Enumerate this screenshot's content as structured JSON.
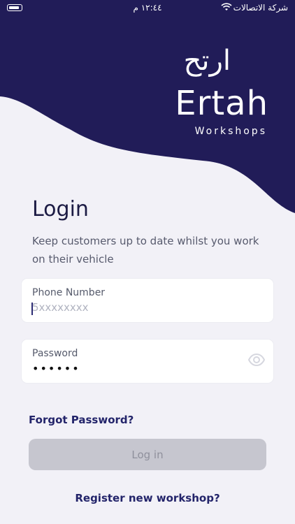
{
  "status_bar": {
    "carrier": "شركة الاتصالات",
    "time": "١٢:٤٤ م"
  },
  "brand": {
    "arabic_name": "ارتح",
    "english_name": "Ertah",
    "subtitle": "Workshops",
    "color": "#211c58"
  },
  "login": {
    "title": "Login",
    "subtitle": "Keep customers up to date whilst you work on their vehicle",
    "phone": {
      "label": "Phone Number",
      "placeholder": "5xxxxxxxx"
    },
    "password": {
      "label": "Password",
      "value": "••••••"
    },
    "forgot_password": "Forgot Password?",
    "login_button": "Log in",
    "register_link": "Register new workshop?"
  }
}
